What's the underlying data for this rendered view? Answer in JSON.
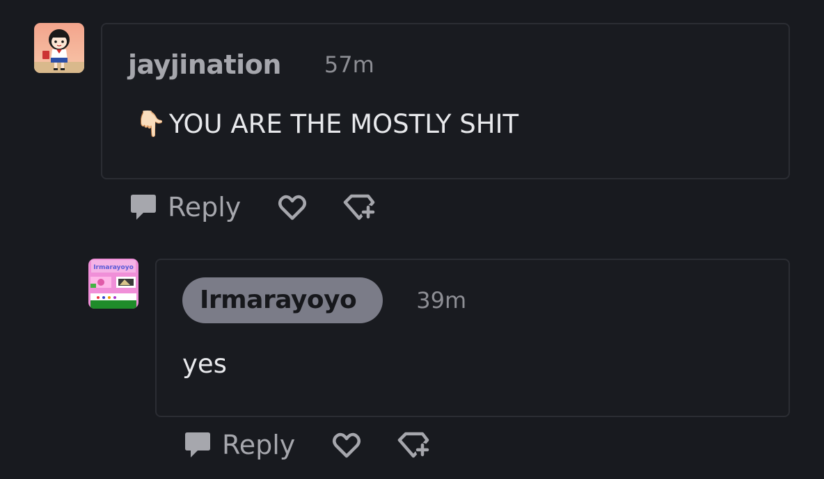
{
  "comments": [
    {
      "username": "jayjination",
      "timestamp": "57m",
      "emoji": "👇🏻",
      "message": "YOU ARE THE MOSTLY SHIT",
      "reply_label": "Reply",
      "avatar_icon": "girl-sailor-uniform-avatar"
    },
    {
      "username": "Irmarayoyo",
      "timestamp": "39m",
      "message": "yes",
      "reply_label": "Reply",
      "avatar_icon": "pink-collage-avatar",
      "avatar_banner_text": "Irmarayoyo"
    }
  ],
  "colors": {
    "background": "#181a1f",
    "card_border": "#2b2d33",
    "username_badge": "#7b7c88",
    "muted_text": "#a6a7ad"
  }
}
